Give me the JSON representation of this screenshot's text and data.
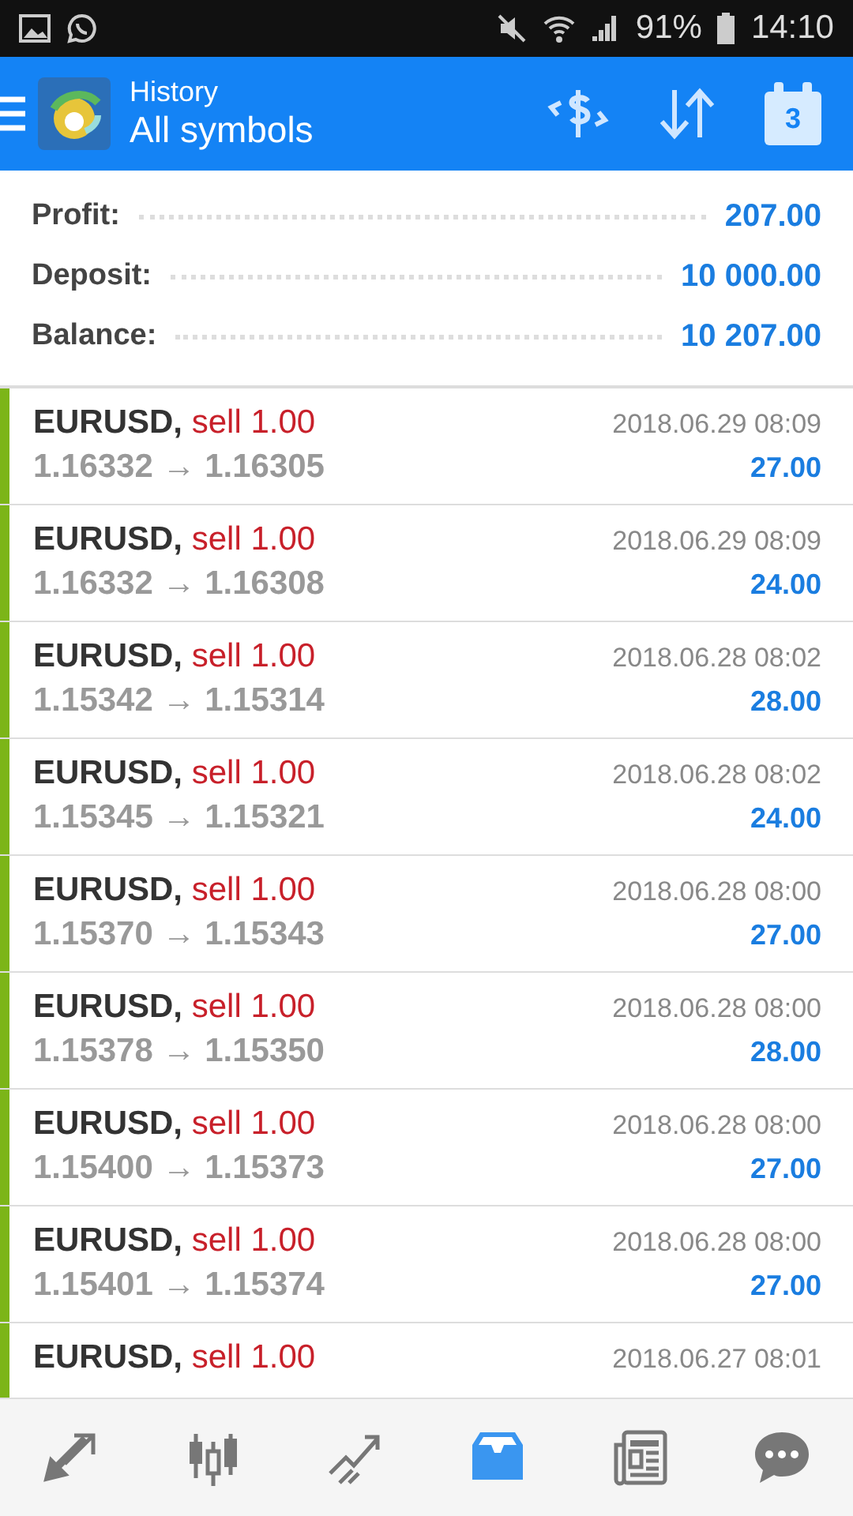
{
  "status_bar": {
    "battery": "91%",
    "time": "14:10"
  },
  "header": {
    "title": "History",
    "subtitle": "All symbols",
    "calendar_day": "3"
  },
  "summary": [
    {
      "label": "Profit:",
      "value": "207.00"
    },
    {
      "label": "Deposit:",
      "value": "10 000.00"
    },
    {
      "label": "Balance:",
      "value": "10 207.00"
    }
  ],
  "deals": [
    {
      "symbol": "EURUSD,",
      "side": "sell 1.00",
      "prices": "1.16332 → 1.16305",
      "time": "2018.06.29 08:09",
      "profit": "27.00"
    },
    {
      "symbol": "EURUSD,",
      "side": "sell 1.00",
      "prices": "1.16332 → 1.16308",
      "time": "2018.06.29 08:09",
      "profit": "24.00"
    },
    {
      "symbol": "EURUSD,",
      "side": "sell 1.00",
      "prices": "1.15342 → 1.15314",
      "time": "2018.06.28 08:02",
      "profit": "28.00"
    },
    {
      "symbol": "EURUSD,",
      "side": "sell 1.00",
      "prices": "1.15345 → 1.15321",
      "time": "2018.06.28 08:02",
      "profit": "24.00"
    },
    {
      "symbol": "EURUSD,",
      "side": "sell 1.00",
      "prices": "1.15370 → 1.15343",
      "time": "2018.06.28 08:00",
      "profit": "27.00"
    },
    {
      "symbol": "EURUSD,",
      "side": "sell 1.00",
      "prices": "1.15378 → 1.15350",
      "time": "2018.06.28 08:00",
      "profit": "28.00"
    },
    {
      "symbol": "EURUSD,",
      "side": "sell 1.00",
      "prices": "1.15400 → 1.15373",
      "time": "2018.06.28 08:00",
      "profit": "27.00"
    },
    {
      "symbol": "EURUSD,",
      "side": "sell 1.00",
      "prices": "1.15401 → 1.15374",
      "time": "2018.06.28 08:00",
      "profit": "27.00"
    },
    {
      "symbol": "EURUSD,",
      "side": "sell 1.00",
      "time": "2018.06.27 08:01"
    }
  ],
  "nav": [
    {
      "kind": "trade",
      "selected": false
    },
    {
      "kind": "candles",
      "selected": false
    },
    {
      "kind": "chart",
      "selected": false
    },
    {
      "kind": "history",
      "selected": true
    },
    {
      "kind": "news",
      "selected": false
    },
    {
      "kind": "chat",
      "selected": false
    }
  ]
}
